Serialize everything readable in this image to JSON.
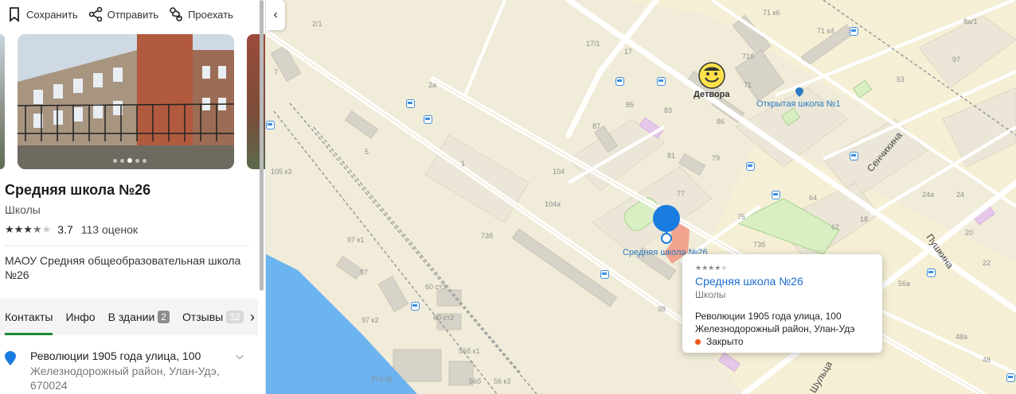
{
  "actions": {
    "save": "Сохранить",
    "share": "Отправить",
    "route": "Проехать"
  },
  "org": {
    "title": "Средняя школа №26",
    "category": "Школы",
    "rating_value": "3.7",
    "rating_stars": 3.7,
    "rating_count": "113 оценок",
    "description": "МАОУ Средняя общеобразовательная школа №26"
  },
  "tabs": [
    {
      "label": "Контакты",
      "active": true
    },
    {
      "label": "Инфо"
    },
    {
      "label": "В здании",
      "badge": "2"
    },
    {
      "label": "Отзывы",
      "badge": "32"
    }
  ],
  "address": {
    "line1": "Революции 1905 года улица, 100",
    "line2": "Железнодорожный район, Улан-Удэ, 670024"
  },
  "map": {
    "labels": {
      "b1": "2/1",
      "b2": "17/1",
      "b3": "17",
      "b4": "71 к6",
      "b5": "71 к4",
      "b6": "8а/1",
      "b7": "7",
      "b8": "2а",
      "b9": "71б",
      "b10": "71",
      "b11": "97",
      "b12": "85",
      "b13": "83",
      "b14": "86",
      "b15": "53",
      "b16": "87",
      "b17": "81",
      "b18": "79",
      "b19": "5",
      "b20": "1",
      "b21": "104",
      "b22": "104а",
      "b23": "77",
      "b24": "75",
      "b25": "73б",
      "b26": "64",
      "b27": "24а",
      "b28": "24",
      "b29": "62",
      "b30": "18",
      "b31": "20",
      "b32": "22",
      "b33": "105 к3",
      "b34": "97 к1",
      "b35": "73б",
      "b36": "97",
      "b37": "60 ст3",
      "b38": "97 к2",
      "b39": "60 ст2",
      "b40": "56б к1",
      "b41": "56б",
      "b42": "56 к3",
      "b43": "97а к5",
      "b44": "98",
      "b45": "56а",
      "b46": "48а",
      "b47": "48"
    },
    "streets": {
      "s1": "Сенчихина",
      "s2": "Пушкина",
      "s3": "Шульца"
    },
    "poi_detvora": "Детвора",
    "poi_open_school": "Открытая школа №1",
    "poi_school26": "Средняя школа №26"
  },
  "popup": {
    "stars": 3.7,
    "title": "Средняя школа №26",
    "category": "Школы",
    "address_line1": "Революции 1905 года улица, 100",
    "address_line2": "Железнодорожный район, Улан-Удэ",
    "status": "Закрыто",
    "status_color": "#f0541a"
  },
  "colors": {
    "accent": "#1a8a2e",
    "link": "#1c6dd0",
    "pin": "#1a7ce0",
    "water": "#6bb4ef"
  }
}
